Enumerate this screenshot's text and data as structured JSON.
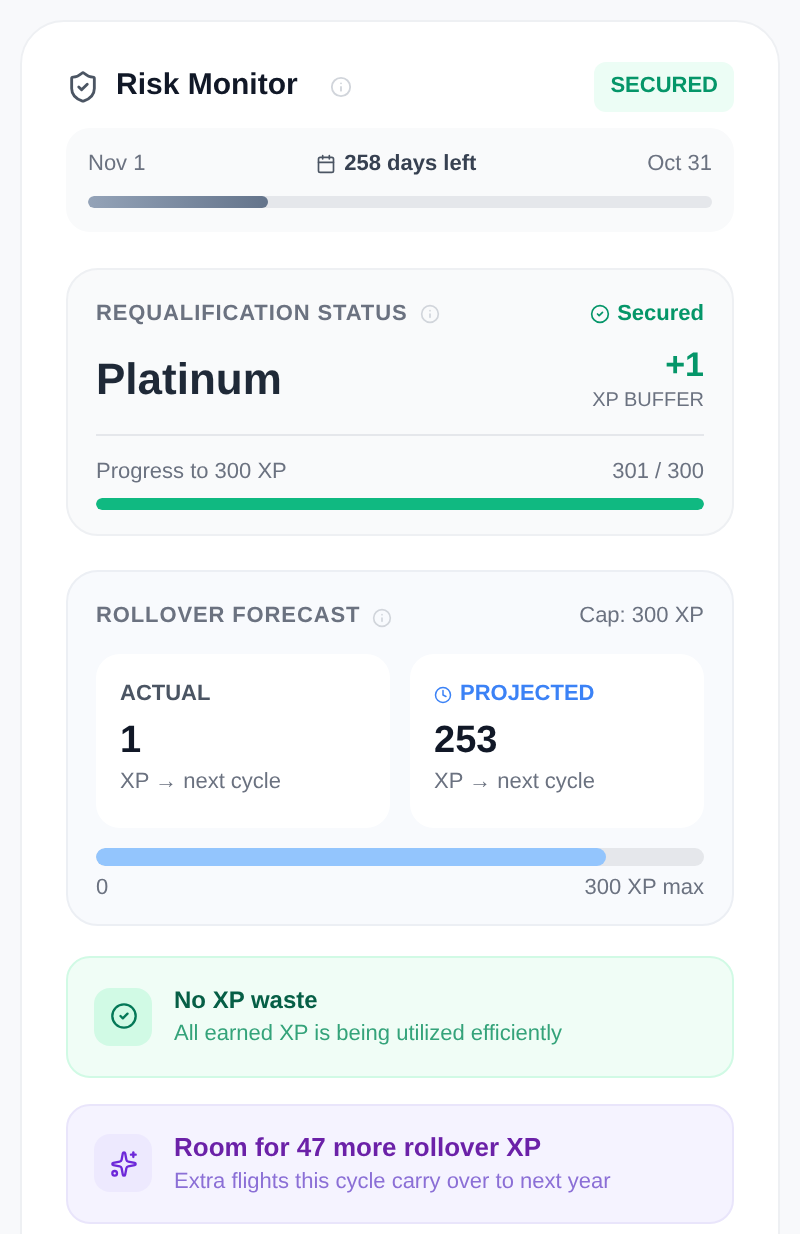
{
  "header": {
    "title": "Risk Monitor",
    "badge": "SECURED"
  },
  "timeline": {
    "start": "Nov 1",
    "remaining": "258 days left",
    "end": "Oct 31",
    "level": 0.29
  },
  "requalification": {
    "title": "REQUALIFICATION STATUS",
    "status": "Secured",
    "tier": "Platinum",
    "buffer_value": "+1",
    "buffer_label": "XP BUFFER",
    "progress_label": "Progress to 300 XP",
    "progress_reading": "301 / 300",
    "level": 1
  },
  "rollover": {
    "title": "ROLLOVER FORECAST",
    "cap": "Cap: 300 XP",
    "tiles": [
      {
        "kind": "actual",
        "label": "ACTUAL",
        "value": "1",
        "unit": "XP → next cycle"
      },
      {
        "kind": "projected",
        "label": "PROJECTED",
        "value": "253",
        "unit": "XP → next cycle"
      }
    ],
    "level": 0.84,
    "scale_min": "0",
    "scale_max": "300 XP max"
  },
  "alerts": [
    {
      "kind": "success",
      "title": "No XP waste",
      "text": "All earned XP is being utilized efficiently"
    },
    {
      "kind": "opportunity",
      "title": "Room for 47 more rollover XP",
      "text": "Extra flights this cycle carry over to next year"
    }
  ]
}
